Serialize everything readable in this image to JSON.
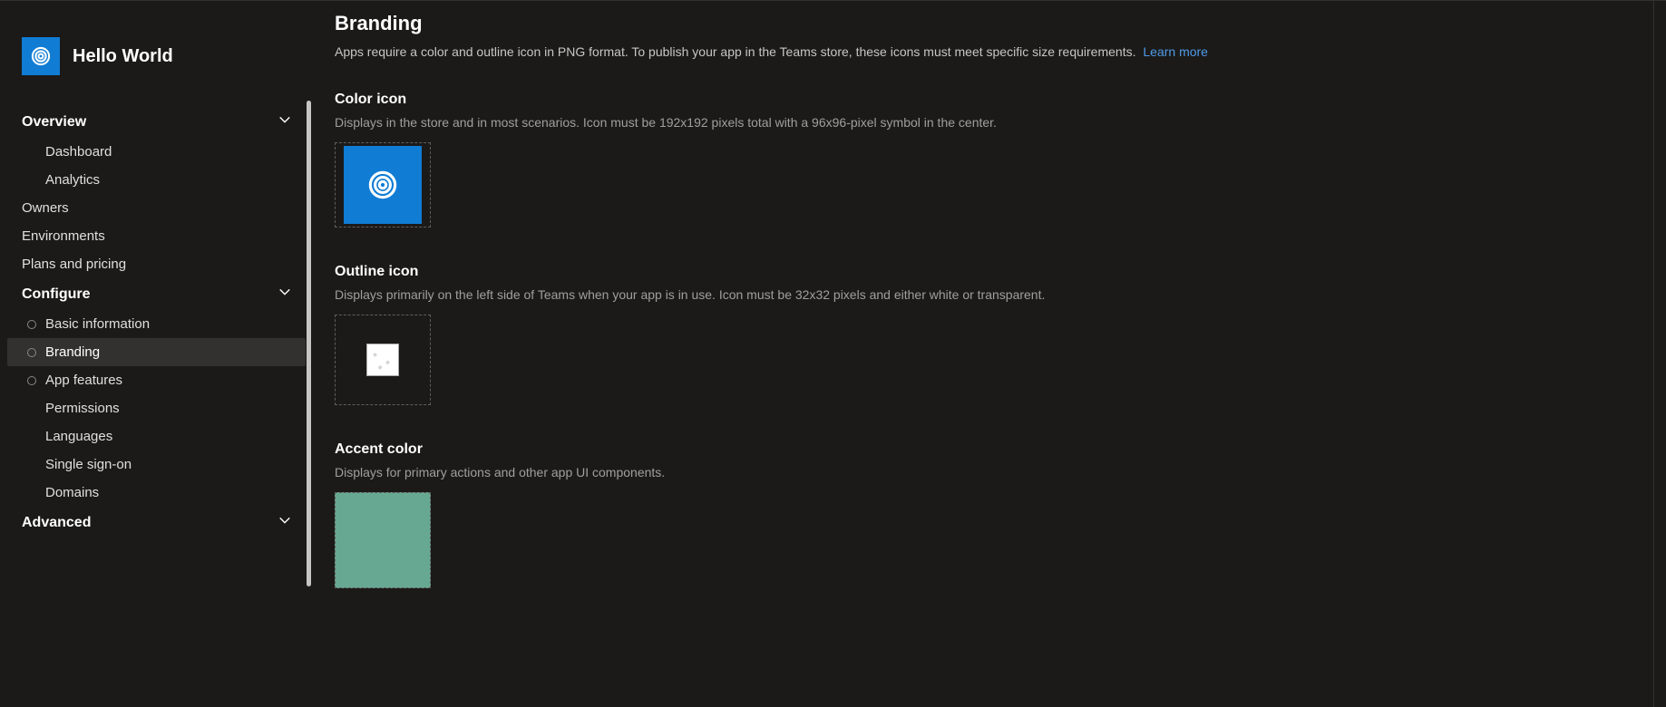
{
  "app": {
    "title": "Hello World"
  },
  "sidebar": {
    "sections": [
      {
        "label": "Overview",
        "expanded": true,
        "items": [
          {
            "label": "Dashboard",
            "bullet": false
          },
          {
            "label": "Analytics",
            "bullet": false
          }
        ]
      }
    ],
    "top_items": [
      {
        "label": "Owners"
      },
      {
        "label": "Environments"
      },
      {
        "label": "Plans and pricing"
      }
    ],
    "configure": {
      "label": "Configure",
      "expanded": true,
      "items": [
        {
          "label": "Basic information",
          "bullet": true
        },
        {
          "label": "Branding",
          "bullet": true,
          "active": true
        },
        {
          "label": "App features",
          "bullet": true
        },
        {
          "label": "Permissions",
          "bullet": false
        },
        {
          "label": "Languages",
          "bullet": false
        },
        {
          "label": "Single sign-on",
          "bullet": false
        },
        {
          "label": "Domains",
          "bullet": false
        }
      ]
    },
    "advanced": {
      "label": "Advanced",
      "expanded": false
    }
  },
  "page": {
    "title": "Branding",
    "lead_text": "Apps require a color and outline icon in PNG format. To publish your app in the Teams store, these icons must meet specific size requirements.",
    "learn_more": "Learn more",
    "color_icon": {
      "heading": "Color icon",
      "desc": "Displays in the store and in most scenarios. Icon must be 192x192 pixels total with a 96x96-pixel symbol in the center."
    },
    "outline_icon": {
      "heading": "Outline icon",
      "desc": "Displays primarily on the left side of Teams when your app is in use. Icon must be 32x32 pixels and either white or transparent."
    },
    "accent": {
      "heading": "Accent color",
      "desc": "Displays for primary actions and other app UI components.",
      "value": "#67a893"
    }
  },
  "colors": {
    "brand_blue": "#107cd4"
  }
}
